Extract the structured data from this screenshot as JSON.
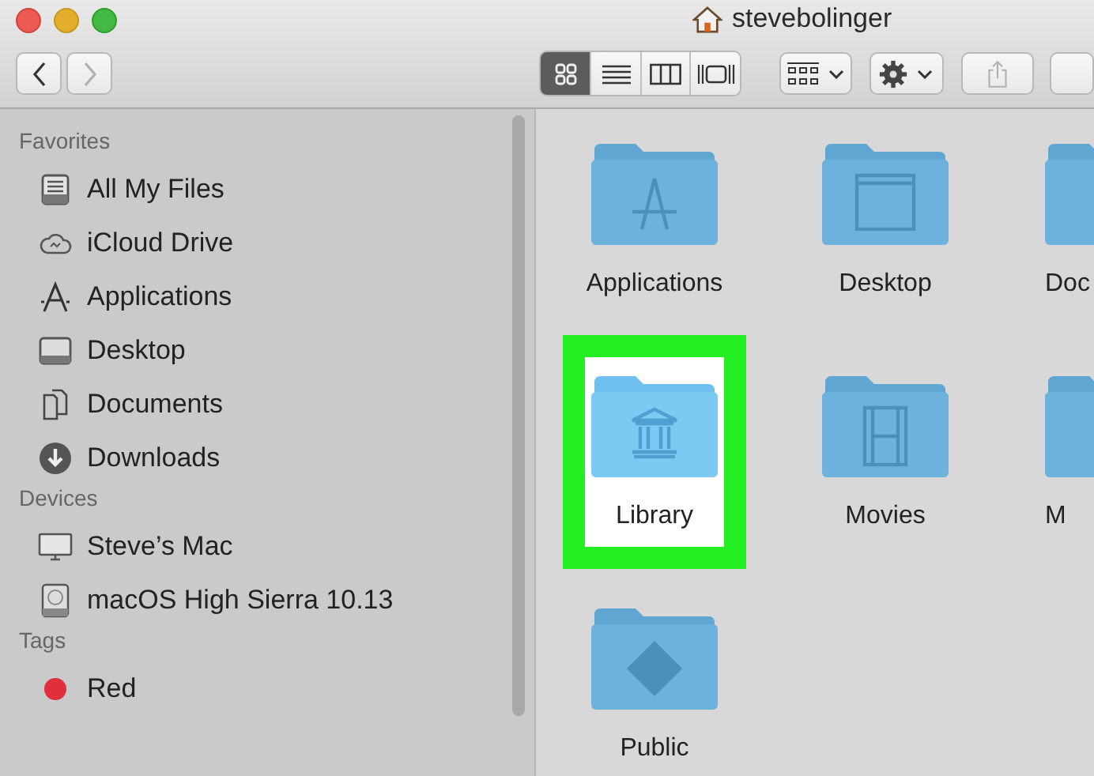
{
  "window": {
    "title": "stevebolinger"
  },
  "toolbar": {
    "back": {
      "disabled": false
    },
    "forward": {
      "disabled": true
    },
    "view_modes": [
      {
        "kind": "icons",
        "selected": true
      },
      {
        "kind": "list",
        "selected": false
      },
      {
        "kind": "columns",
        "selected": false
      },
      {
        "kind": "gallery",
        "selected": false
      }
    ],
    "share": {
      "disabled": true
    }
  },
  "sidebar": {
    "sections": [
      {
        "title": "Favorites",
        "items": [
          {
            "kind": "files",
            "label": "All My Files"
          },
          {
            "kind": "cloud",
            "label": "iCloud Drive"
          },
          {
            "kind": "apps",
            "label": "Applications"
          },
          {
            "kind": "desktop",
            "label": "Desktop"
          },
          {
            "kind": "docs",
            "label": "Documents"
          },
          {
            "kind": "downloads",
            "label": "Downloads"
          }
        ]
      },
      {
        "title": "Devices",
        "items": [
          {
            "kind": "computer",
            "label": "Steve’s Mac"
          },
          {
            "kind": "disk",
            "label": "macOS High Sierra 10.13"
          }
        ]
      },
      {
        "title": "Tags",
        "items": [
          {
            "kind": "tag",
            "label": "Red",
            "color": "#e0303c"
          }
        ]
      }
    ]
  },
  "folders": [
    {
      "kind": "apps",
      "label": "Applications",
      "highlighted": false
    },
    {
      "kind": "desktop",
      "label": "Desktop",
      "highlighted": false
    },
    {
      "kind": "docs",
      "label": "Doc",
      "highlighted": false
    },
    {
      "kind": "library",
      "label": "Library",
      "highlighted": true
    },
    {
      "kind": "movies",
      "label": "Movies",
      "highlighted": false
    },
    {
      "kind": "plain",
      "label": "M",
      "highlighted": false
    },
    {
      "kind": "public",
      "label": "Public",
      "highlighted": false
    }
  ]
}
